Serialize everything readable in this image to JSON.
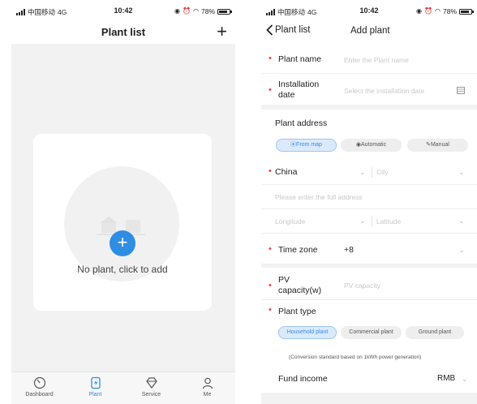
{
  "left": {
    "status": {
      "carrier": "中国移动",
      "network": "4G",
      "time": "10:42",
      "battery": "78%"
    },
    "nav": {
      "title": "Plant list",
      "add_icon": "plus-icon"
    },
    "empty": {
      "message": "No plant, click to add",
      "add_icon": "plus-circle-icon"
    },
    "tabs": [
      {
        "label": "Dashboard",
        "icon": "dashboard-icon"
      },
      {
        "label": "Plant",
        "icon": "plant-icon",
        "active": true
      },
      {
        "label": "Service",
        "icon": "service-icon"
      },
      {
        "label": "Me",
        "icon": "person-icon"
      }
    ]
  },
  "right": {
    "status": {
      "carrier": "中国移动",
      "network": "4G",
      "time": "10:42",
      "battery": "78%"
    },
    "nav": {
      "back_label": "Plant list",
      "title": "Add plant"
    },
    "plant_name": {
      "label": "Plant name",
      "placeholder": "Enter the Plant name"
    },
    "install_date": {
      "label_line1": "Installation",
      "label_line2": "date",
      "placeholder": "Select the installation date"
    },
    "address": {
      "title": "Plant address",
      "modes": [
        "From map",
        "Automatic",
        "Manual"
      ],
      "country": "China",
      "city_placeholder": "City",
      "full_address_placeholder": "Please enter the full address",
      "longitude_placeholder": "Longitude",
      "latitude_placeholder": "Latitude"
    },
    "time_zone": {
      "label": "Time zone",
      "value": "+8"
    },
    "pv_capacity": {
      "label_line1": "PV",
      "label_line2": "capacity(w)",
      "placeholder": "PV capacity"
    },
    "plant_type": {
      "label": "Plant type",
      "options": [
        "Household plant",
        "Commercial plant",
        "Ground plant"
      ],
      "note": "(Conversion standard based on 1kWh power generation)"
    },
    "fund_income": {
      "label": "Fund income",
      "currency": "RMB"
    }
  },
  "colors": {
    "accent": "#2f8de4",
    "required": "#e6453a",
    "background": "#f2f2f2"
  }
}
